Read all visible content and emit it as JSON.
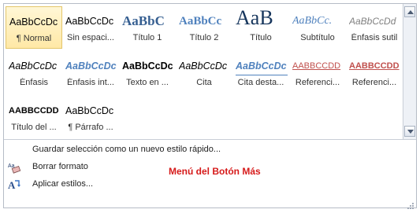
{
  "styles": [
    {
      "preview": "AaBbCcDc",
      "label": "¶ Normal"
    },
    {
      "preview": "AaBbCcDc",
      "label": "Sin espaci..."
    },
    {
      "preview": "AaBbC",
      "label": "Título 1"
    },
    {
      "preview": "AaBbCc",
      "label": "Título 2"
    },
    {
      "preview": "AaB",
      "label": "Título"
    },
    {
      "preview": "AaBbCc.",
      "label": "Subtítulo"
    },
    {
      "preview": "AaBbCcDd",
      "label": "Énfasis sutil"
    },
    {
      "preview": "AaBbCcDc",
      "label": "Énfasis"
    },
    {
      "preview": "AaBbCcDc",
      "label": "Énfasis int..."
    },
    {
      "preview": "AaBbCcDc",
      "label": "Texto en ..."
    },
    {
      "preview": "AaBbCcDc",
      "label": "Cita"
    },
    {
      "preview": "AaBbCcDc",
      "label": "Cita desta..."
    },
    {
      "preview": "AABBCCDD",
      "label": "Referenci..."
    },
    {
      "preview": "AABBCCDD",
      "label": "Referenci..."
    },
    {
      "preview": "AABBCCDD",
      "label": "Título del ..."
    },
    {
      "preview": "AaBbCcDc",
      "label": "¶ Párrafo ..."
    }
  ],
  "menu": {
    "save_selection": "Guardar selección como un nuevo estilo rápido...",
    "clear_format": "Borrar formato",
    "apply_styles": "Aplicar estilos..."
  },
  "caption": "Menú del Botón Más",
  "colors": {
    "heading_blue": "#365f91",
    "light_blue": "#4f81bd",
    "title_navy": "#17365d",
    "reference_red": "#c0504d",
    "caption_red": "#d61a1a",
    "selected_gold": "#e3c56a"
  }
}
